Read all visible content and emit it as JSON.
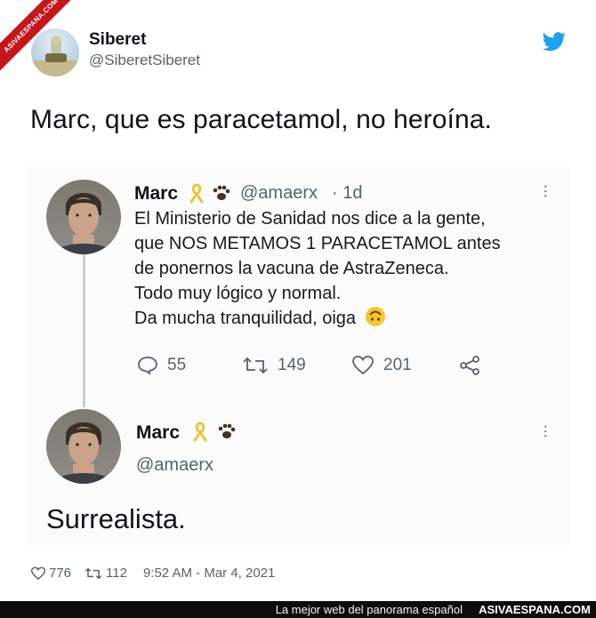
{
  "watermark": {
    "ribbon_text": "ASIVAESPANA.COM"
  },
  "tweet": {
    "author_name": "Siberet",
    "author_handle": "@SiberetSiberet",
    "text": "Marc, que es paracetamol, no heroína.",
    "likes": "776",
    "retweets": "112",
    "timestamp": "9:52 AM - Mar 4, 2021",
    "brand_icon": "twitter-bird-icon",
    "brand_color": "#1da1f2"
  },
  "quoted": {
    "author_name": "Marc",
    "author_handle": "@amaerx",
    "age": "· 1d",
    "lines": [
      "El Ministerio de Sanidad nos dice a la gente,",
      "que NOS METAMOS 1 PARACETAMOL antes",
      "de ponernos la vacuna de AstraZeneca.",
      "Todo muy lógico y normal.",
      "Da mucha tranquilidad, oiga"
    ],
    "emoji": "upside-down-face-icon",
    "replies": "55",
    "retweets": "149",
    "likes": "201"
  },
  "reply": {
    "author_name": "Marc",
    "author_handle": "@amaerx",
    "text": "Surrealista."
  },
  "footer": {
    "tagline": "La mejor web del panorama español",
    "site": "ASIVAESPANA.COM"
  }
}
